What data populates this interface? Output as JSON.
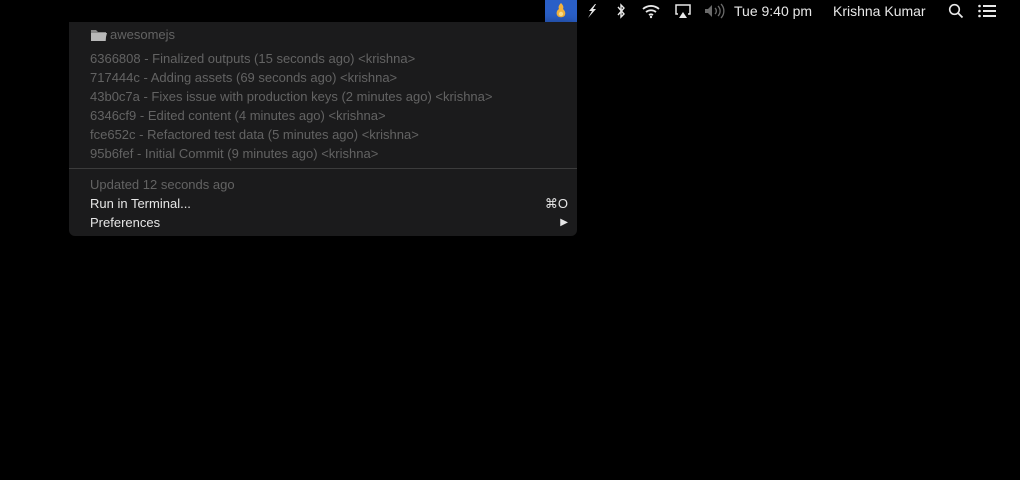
{
  "menubar": {
    "clock": "Tue 9:40 pm",
    "user_name": "Krishna Kumar",
    "icons": [
      "app-status-icon",
      "feather-icon",
      "bluetooth-icon",
      "wifi-icon",
      "airplay-icon",
      "volume-icon",
      "spotlight-icon",
      "notification-center-icon"
    ],
    "active_color": "#2a5fc7"
  },
  "dropdown": {
    "repo_name": "awesomejs",
    "commits": [
      "6366808 - Finalized outputs (15 seconds ago) <krishna>",
      "717444c - Adding assets (69 seconds ago) <krishna>",
      "43b0c7a - Fixes issue with production keys (2 minutes ago) <krishna>",
      "6346cf9 - Edited content (4 minutes ago) <krishna>",
      "fce652c - Refactored test data (5 minutes ago) <krishna>",
      "95b6fef - Initial Commit (9 minutes ago) <krishna>"
    ],
    "updated_text": "Updated 12 seconds ago",
    "run_terminal_label": "Run in Terminal...",
    "run_terminal_shortcut": "⌘O",
    "preferences_label": "Preferences",
    "submenu_arrow": "▶"
  }
}
